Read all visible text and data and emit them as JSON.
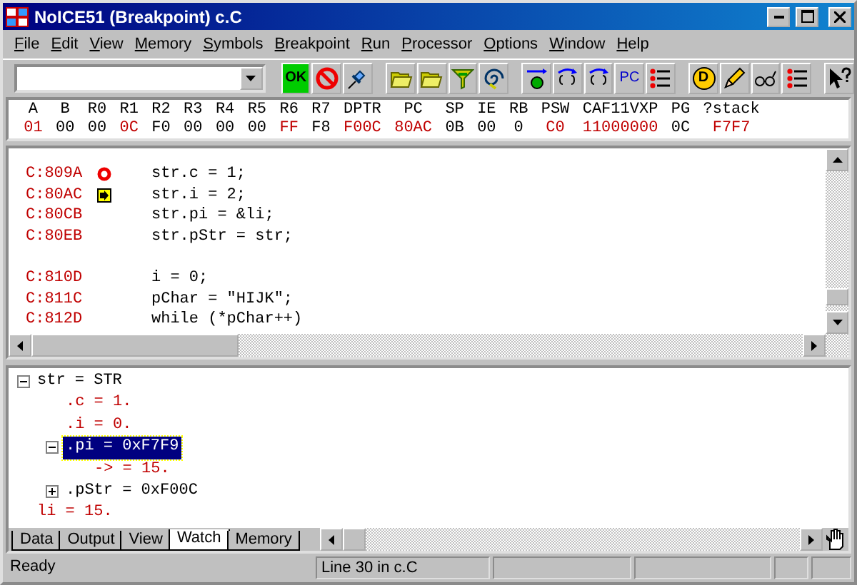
{
  "window": {
    "title": "NoICE51 (Breakpoint) c.C"
  },
  "menu": [
    {
      "label": "File"
    },
    {
      "label": "Edit"
    },
    {
      "label": "View"
    },
    {
      "label": "Memory"
    },
    {
      "label": "Symbols"
    },
    {
      "label": "Breakpoint"
    },
    {
      "label": "Run"
    },
    {
      "label": "Processor"
    },
    {
      "label": "Options"
    },
    {
      "label": "Window"
    },
    {
      "label": "Help"
    }
  ],
  "toolbar": [
    {
      "kind": "ok",
      "label": "OK"
    },
    {
      "kind": "stop"
    },
    {
      "kind": "pin"
    },
    {
      "kind": "separator"
    },
    {
      "kind": "folder"
    },
    {
      "kind": "folder"
    },
    {
      "kind": "funnel"
    },
    {
      "kind": "spiral"
    },
    {
      "kind": "separator"
    },
    {
      "kind": "step"
    },
    {
      "kind": "braces"
    },
    {
      "kind": "braces"
    },
    {
      "kind": "pc",
      "label": "PC"
    },
    {
      "kind": "list"
    },
    {
      "kind": "separator"
    },
    {
      "kind": "d",
      "label": "D"
    },
    {
      "kind": "pencil"
    },
    {
      "kind": "glasses"
    },
    {
      "kind": "list"
    },
    {
      "kind": "separator"
    },
    {
      "kind": "help"
    }
  ],
  "registers": [
    {
      "name": "A",
      "value": "01",
      "changed": true
    },
    {
      "name": "B",
      "value": "00",
      "changed": false
    },
    {
      "name": "R0",
      "value": "00",
      "changed": false
    },
    {
      "name": "R1",
      "value": "0C",
      "changed": true
    },
    {
      "name": "R2",
      "value": "F0",
      "changed": false
    },
    {
      "name": "R3",
      "value": "00",
      "changed": false
    },
    {
      "name": "R4",
      "value": "00",
      "changed": false
    },
    {
      "name": "R5",
      "value": "00",
      "changed": false
    },
    {
      "name": "R6",
      "value": "FF",
      "changed": true
    },
    {
      "name": "R7",
      "value": "F8",
      "changed": false
    },
    {
      "name": "DPTR",
      "value": "F00C",
      "changed": true
    },
    {
      "name": "PC",
      "value": "80AC",
      "changed": true
    },
    {
      "name": "SP",
      "value": "0B",
      "changed": false
    },
    {
      "name": "IE",
      "value": "00",
      "changed": false
    },
    {
      "name": "RB",
      "value": "0",
      "changed": false
    },
    {
      "name": "PSW",
      "value": "C0",
      "changed": true
    },
    {
      "name": "CAF11VXP",
      "value": "11000000",
      "changed": true
    },
    {
      "name": "PG",
      "value": "0C",
      "changed": false
    },
    {
      "name": "?stack",
      "value": "F7F7",
      "changed": true
    }
  ],
  "source": [
    {
      "kind": "code",
      "address": "C:809A",
      "code": "str.c = 1;",
      "breakpoint": true,
      "current": false
    },
    {
      "kind": "code",
      "address": "C:80AC",
      "code": "str.i = 2;",
      "breakpoint": false,
      "current": true
    },
    {
      "kind": "code",
      "address": "C:80CB",
      "code": "str.pi = &li;",
      "breakpoint": false,
      "current": false
    },
    {
      "kind": "code",
      "address": "C:80EB",
      "code": "str.pStr = str;",
      "breakpoint": false,
      "current": false
    },
    {
      "kind": "blank"
    },
    {
      "kind": "code",
      "address": "C:810D",
      "code": "i = 0;",
      "breakpoint": false,
      "current": false
    },
    {
      "kind": "code",
      "address": "C:811C",
      "code": "pChar = \"HIJK\";",
      "breakpoint": false,
      "current": false
    },
    {
      "kind": "code",
      "address": "C:812D",
      "code": "while (*pChar++)",
      "breakpoint": false,
      "current": false
    }
  ],
  "watch": [
    {
      "text": "str = STR",
      "changed": false,
      "selected": false,
      "expanded": true,
      "children": [
        {
          "text": ".c = 1.",
          "changed": true,
          "selected": false
        },
        {
          "text": ".i = 0.",
          "changed": true,
          "selected": false
        },
        {
          "text": ".pi = 0xF7F9",
          "selected": true,
          "expanded": true,
          "children": [
            {
              "text": "-> = 15.",
              "changed": true,
              "selected": false
            }
          ]
        },
        {
          "text": ".pStr = 0xF00C",
          "changed": false,
          "selected": false,
          "expanded": false
        }
      ]
    },
    {
      "text": "li = 15.",
      "changed": true,
      "selected": false
    }
  ],
  "tabs": [
    {
      "label": "Data",
      "selected": false
    },
    {
      "label": "Output",
      "selected": false
    },
    {
      "label": "View",
      "selected": false
    },
    {
      "label": "Watch",
      "selected": true
    },
    {
      "label": "Memory",
      "selected": false
    }
  ],
  "status_bar": {
    "message": "Ready",
    "position": "Line 30 in c.C"
  }
}
